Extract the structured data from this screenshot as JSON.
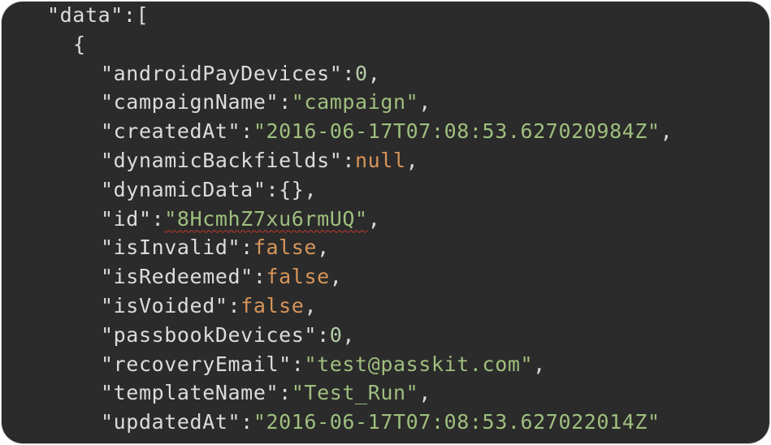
{
  "editor": {
    "root_key": "\"data\"",
    "root_open": ":[",
    "object_open": "{",
    "lines": [
      {
        "key": "\"androidPayDevices\"",
        "sep": ":",
        "value": "0",
        "type": "num",
        "trail": ","
      },
      {
        "key": "\"campaignName\"",
        "sep": ":",
        "value": "\"campaign\"",
        "type": "str",
        "trail": ","
      },
      {
        "key": "\"createdAt\"",
        "sep": ":",
        "value": "\"2016-06-17T07:08:53.627020984Z\"",
        "type": "str",
        "trail": ","
      },
      {
        "key": "\"dynamicBackfields\"",
        "sep": ":",
        "value": "null",
        "type": "kw",
        "trail": ","
      },
      {
        "key": "\"dynamicData\"",
        "sep": ":",
        "value": "{}",
        "type": "punct",
        "trail": ","
      },
      {
        "key": "\"id\"",
        "sep": ":",
        "value": "\"8HcmhZ7xu6rmUQ\"",
        "type": "str",
        "trail": ","
      },
      {
        "key": "\"isInvalid\"",
        "sep": ":",
        "value": "false",
        "type": "kw",
        "trail": ","
      },
      {
        "key": "\"isRedeemed\"",
        "sep": ":",
        "value": "false",
        "type": "kw",
        "trail": ","
      },
      {
        "key": "\"isVoided\"",
        "sep": ":",
        "value": "false",
        "type": "kw",
        "trail": ","
      },
      {
        "key": "\"passbookDevices\"",
        "sep": ":",
        "value": "0",
        "type": "num",
        "trail": ","
      },
      {
        "key": "\"recoveryEmail\"",
        "sep": ":",
        "value": "\"test@passkit.com\"",
        "type": "str",
        "trail": ","
      },
      {
        "key": "\"templateName\"",
        "sep": ":",
        "value": "\"Test_Run\"",
        "type": "str",
        "trail": ","
      },
      {
        "key": "\"updatedAt\"",
        "sep": ":",
        "value": "\"2016-06-17T07:08:53.627022014Z\"",
        "type": "str",
        "trail": ""
      }
    ],
    "colors": {
      "background": "#2b2b2b",
      "key": "#dcdcdc",
      "string": "#9fbf7e",
      "number": "#b5cea8",
      "keyword": "#d7955a",
      "spellcheck_underline": "#c0392b"
    }
  }
}
